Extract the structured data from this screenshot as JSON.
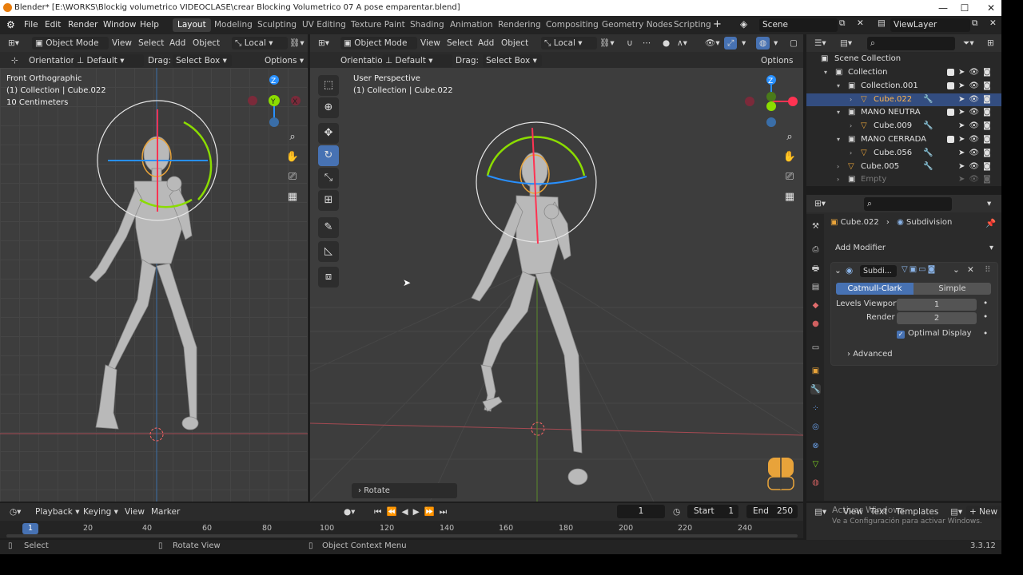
{
  "window": {
    "title": "Blender* [E:\\WORKS\\Blockig volumetrico VIDEOCLASE\\crear Blocking Volumetrico 07 A pose emparentar.blend]",
    "minimize": "—",
    "maximize": "☐",
    "close": "✕"
  },
  "menu": [
    "File",
    "Edit",
    "Render",
    "Window",
    "Help"
  ],
  "workspaces": [
    "Layout",
    "Modeling",
    "Sculpting",
    "UV Editing",
    "Texture Paint",
    "Shading",
    "Animation",
    "Rendering",
    "Compositing",
    "Geometry Nodes",
    "Scripting"
  ],
  "scene": "Scene",
  "view_layer": "ViewLayer",
  "left_viewport": {
    "mode": "Object Mode",
    "menus": [
      "View",
      "Select",
      "Add",
      "Object"
    ],
    "transform": "Local",
    "orientation_label": "Orientation:",
    "orientation_value": "Default",
    "drag_label": "Drag:",
    "drag_value": "Select Box",
    "options": "Options",
    "view_name": "Front Orthographic",
    "collection_info": "(1) Collection | Cube.022",
    "scale_info": "10 Centimeters",
    "gizmo": {
      "z": "Z",
      "y": "Y",
      "x": "X"
    }
  },
  "right_viewport": {
    "mode": "Object Mode",
    "menus": [
      "View",
      "Select",
      "Add",
      "Object"
    ],
    "transform": "Local",
    "orientation_label": "Orientation:",
    "orientation_value": "Default",
    "drag_label": "Drag:",
    "drag_value": "Select Box",
    "options": "Options",
    "view_name": "User Perspective",
    "collection_info": "(1) Collection | Cube.022",
    "last_op": "Rotate",
    "gizmo": {
      "z": "Z"
    }
  },
  "outliner": {
    "root": "Scene Collection",
    "items": [
      {
        "label": "Collection",
        "indent": 0
      },
      {
        "label": "Collection.001",
        "indent": 1
      },
      {
        "label": "Cube.022",
        "indent": 2,
        "selected": true
      },
      {
        "label": "MANO NEUTRA",
        "indent": 1
      },
      {
        "label": "Cube.009",
        "indent": 2
      },
      {
        "label": "MANO CERRADA",
        "indent": 1
      },
      {
        "label": "Cube.056",
        "indent": 2
      },
      {
        "label": "Cube.005",
        "indent": 1
      },
      {
        "label": "Empty",
        "indent": 1,
        "dim": true
      }
    ]
  },
  "properties": {
    "object": "Cube.022",
    "modifier_path": "Subdivision",
    "add_modifier": "Add Modifier",
    "modifier_name": "Subdi...",
    "tabs": [
      "Catmull-Clark",
      "Simple"
    ],
    "levels_viewport_label": "Levels Viewport",
    "levels_viewport": "1",
    "render_label": "Render",
    "render": "2",
    "optimal_display": "Optimal Display",
    "advanced": "Advanced"
  },
  "timeline": {
    "menus": [
      "Playback",
      "Keying",
      "View",
      "Marker"
    ],
    "current_frame": "1",
    "start_label": "Start",
    "start": "1",
    "end_label": "End",
    "end": "250",
    "ticks": [
      "1",
      "20",
      "40",
      "60",
      "80",
      "100",
      "120",
      "140",
      "160",
      "180",
      "200",
      "220",
      "240"
    ]
  },
  "asset_bar": {
    "view": "View",
    "text": "Text",
    "templates": "Templates",
    "new": "New",
    "watermark1": "Activar Windows",
    "watermark2": "Ve a Configuración para activar Windows."
  },
  "status": {
    "select": "Select",
    "rotate": "Rotate View",
    "context": "Object Context Menu",
    "version": "3.3.12"
  },
  "colors": {
    "accent": "#4772b3",
    "orange": "#e8a33a",
    "x_axis": "#ff3352",
    "y_axis": "#8bdc00",
    "z_axis": "#2890ff"
  }
}
